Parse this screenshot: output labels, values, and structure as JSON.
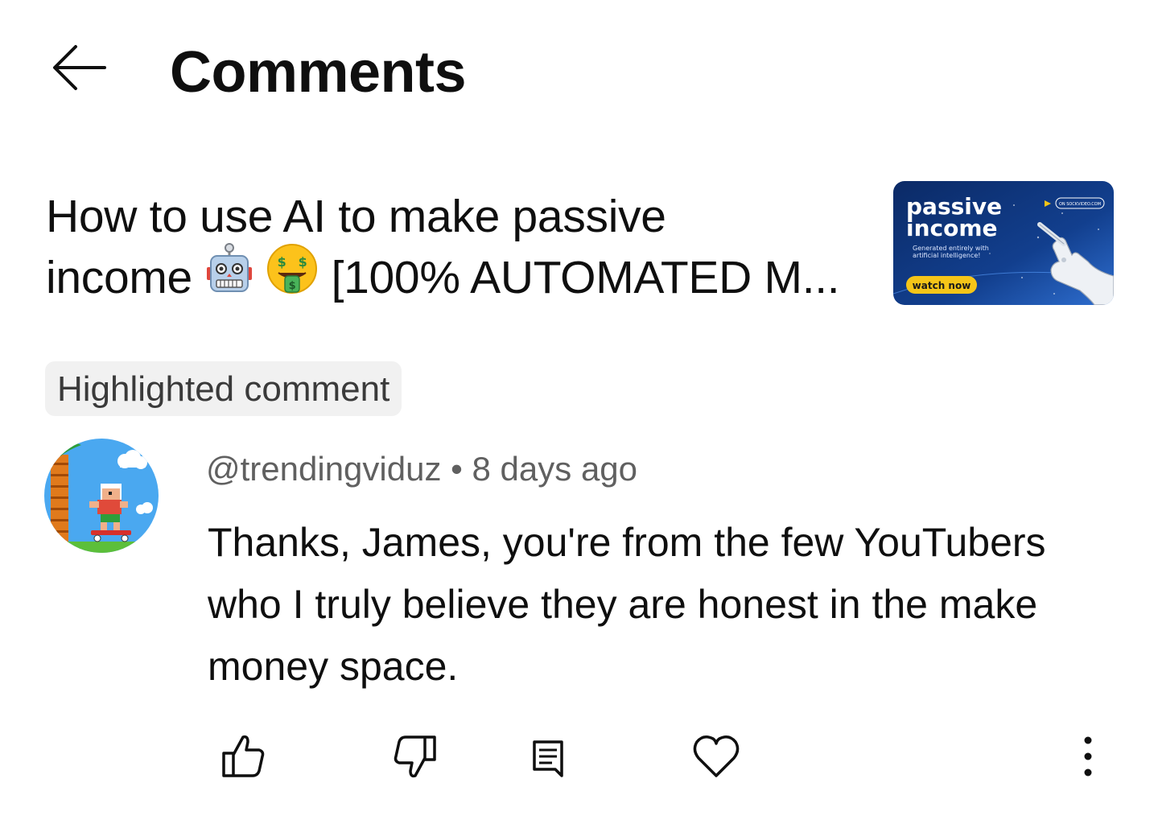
{
  "header": {
    "title": "Comments",
    "back_icon": "arrow-left-icon"
  },
  "video": {
    "title_line1": "How to use AI to make passive",
    "title_line2_prefix": "income",
    "title_line2_suffix": "[100% AUTOMATED M...",
    "emojis": [
      "robot-face-icon",
      "money-mouth-face-icon"
    ],
    "thumbnail": {
      "headline1": "passive",
      "headline2": "income",
      "subtext_line1": "Generated entirely with",
      "subtext_line2": "artificial intelligence!",
      "button": "watch now",
      "corner_tag": "ON SOCKVIDEO.COM",
      "bg_color": "#0b2a66",
      "accent_color": "#f5c518"
    }
  },
  "highlight": {
    "label": "Highlighted comment"
  },
  "comment": {
    "handle": "@trendingviduz",
    "separator": "•",
    "age": "8 days ago",
    "text": "Thanks, James, you're from the few YouTubers who I truly believe they are honest in the make money space."
  },
  "actions": {
    "icons": [
      "thumbs-up-icon",
      "thumbs-down-icon",
      "reply-icon",
      "heart-icon",
      "more-vert-icon"
    ]
  },
  "colors": {
    "text_primary": "#0f0f0f",
    "text_secondary": "#606060",
    "pill_bg": "#f1f1f1"
  }
}
